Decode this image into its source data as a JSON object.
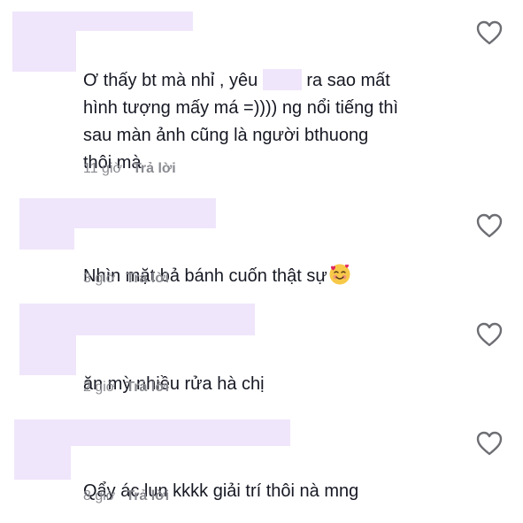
{
  "comments": [
    {
      "text_before_redact": "Ơ thấy bt mà nhỉ , yêu",
      "text_after_redact": "ra sao mất\nhình tượng mấy má =)))) ng nổi tiếng thì\nsau màn ảnh cũng là người bthuong\nthôi mà",
      "time": "11 giờ",
      "reply": "Trả lời"
    },
    {
      "text": "Nhìn mặt bả bánh cuốn thật sự",
      "emoji": "smiling-face-with-hearts",
      "time": "3 giờ",
      "reply": "Trả lời"
    },
    {
      "text": "ăn mỳ nhiều rửa hà chị",
      "time": "2 giờ",
      "reply": "Trả lời"
    },
    {
      "text": "Qẩy ác lun kkkk giải trí thôi nà mng",
      "time": "8 giờ",
      "reply": "Trả lời"
    }
  ],
  "like_icon": "heart-outline-icon",
  "colors": {
    "text": "#161823",
    "meta": "#8a8b91",
    "redaction": "#efe6fb",
    "icon": "#6d6e73"
  }
}
